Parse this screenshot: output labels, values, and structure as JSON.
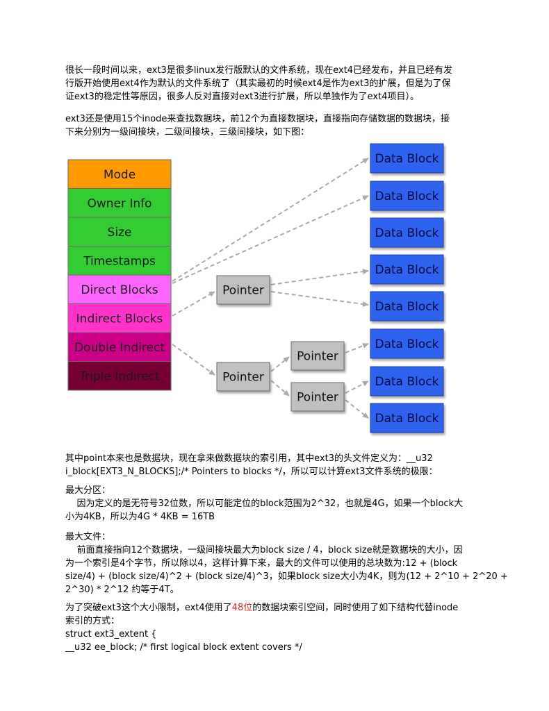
{
  "intro": {
    "lines": [
      "很长一段时间以来，ext3是很多linux发行版默认的文件系统，现在ext4已经发布，并且已经有发",
      "行版开始使用ext4作为默认的文件系统了（其实最初的时候ext4是作为ext3的扩展，但是为了保",
      "证ext3的稳定性等原因，很多人反对直接对ext3进行扩展，所以单独作为了ext4项目）。"
    ]
  },
  "inode_intro": {
    "lines": [
      "ext3还是使用15个inode来查找数据块，前12个为直接数据块，直接指向存储数据的数据块，接",
      "下来分别为一级间接块，二级间接块，三级间接块，如下图："
    ]
  },
  "diagram": {
    "inode_fields": [
      {
        "label": "Mode",
        "color": "#ff9a00"
      },
      {
        "label": "Owner Info",
        "color": "#33cc33"
      },
      {
        "label": "Size",
        "color": "#33cc33"
      },
      {
        "label": "Timestamps",
        "color": "#33cc33"
      },
      {
        "label": "Direct Blocks",
        "color": "#ff66ff"
      },
      {
        "label": "Indirect Blocks",
        "color": "#ff33cc"
      },
      {
        "label": "Double Indirect",
        "color": "#cc0088"
      },
      {
        "label": "Triple Indirect",
        "color": "#770033"
      }
    ],
    "pointer_label": "Pointer",
    "data_block_label": "Data Block",
    "colors": {
      "data_block": "#2f63f0",
      "pointer": "#c0c0c0",
      "arrow": "#aaaaaa"
    }
  },
  "point_para": {
    "lines": [
      "其中point本来也是数据块，现在拿来做数据块的索引用，其中ext3的头文件定义为：__u32",
      "i_block[EXT3_N_BLOCKS];/* Pointers to blocks */，所以可以计算ext3文件系统的极限："
    ]
  },
  "max_partition": {
    "title": "最大分区：",
    "lines": [
      "    因为定义的是无符号32位数，所以可能定位的block范围为2^32，也就是4G，如果一个block大",
      "小为4KB，所以为4G * 4KB = 16TB"
    ]
  },
  "max_file": {
    "title": "最大文件：",
    "lines": [
      "    前面直接指向12个数据块，一级间接块最大为block size / 4，block size就是数据块的大小，因",
      "为一个索引是4个字节，所以除以4，这样计算下来，最大的文件可以使用的总块数为:12 + (block",
      "size/4) + (block size/4)^2 + (block size/4)^3，如果block size大小为4K，则为(12 + 2^10 + 2^20 +",
      "2^30) * 2^12 约等于4T。"
    ]
  },
  "ext4_para": {
    "pre": "为了突破ext3这个大小限制，ext4使用了",
    "highlight": "48位",
    "post": "的数据块索引空间，同时使用了如下结构代替inode",
    "line2": "索引的方式：",
    "highlight_color": "#e0261b"
  },
  "code": {
    "lines": [
      "struct ext3_extent {",
      "__u32 ee_block; /* first logical block extent covers */"
    ]
  }
}
